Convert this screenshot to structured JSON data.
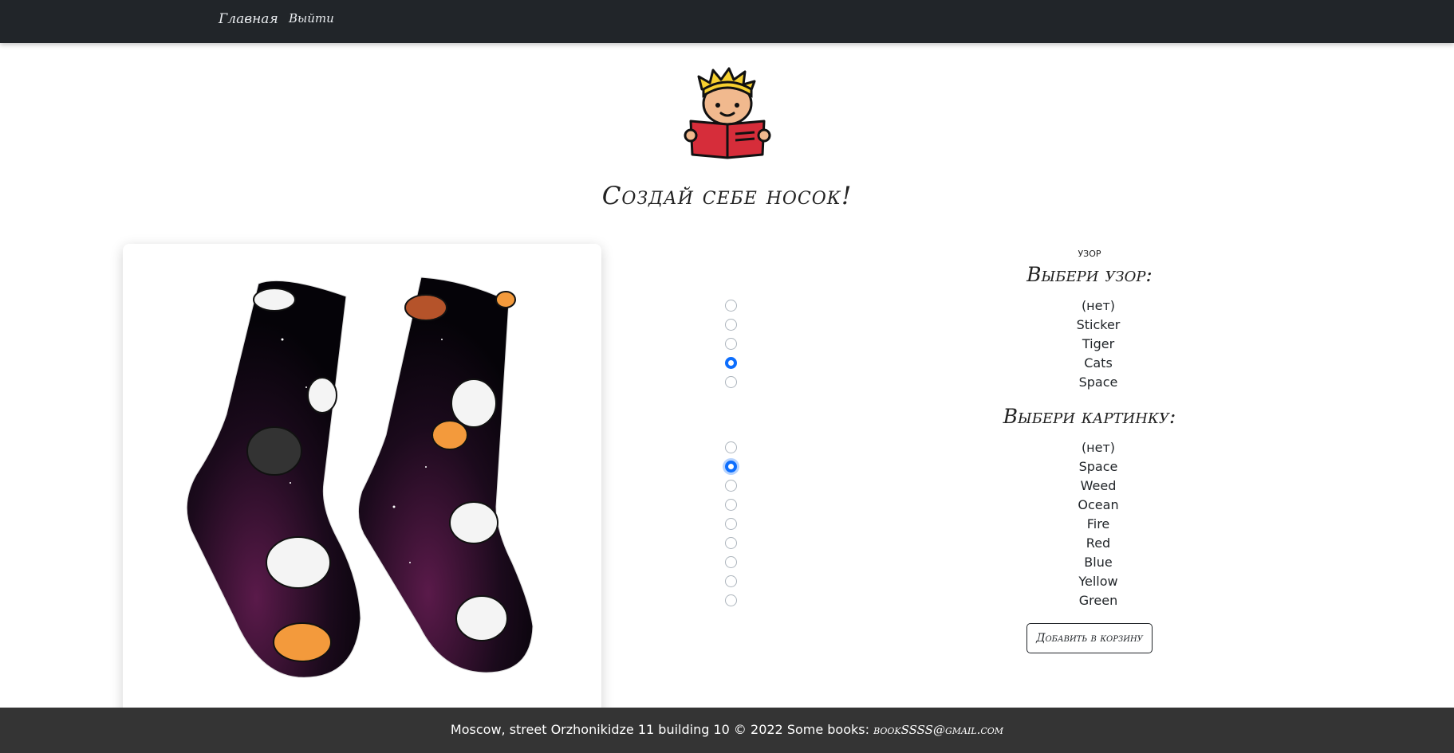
{
  "nav": {
    "home_label": "Главная",
    "logout_label": "Выйти"
  },
  "logo": {
    "icon": "reading-boy-icon"
  },
  "page_title": "Создай себе носок!",
  "pattern_section": {
    "caption": "узор",
    "title": "Выбери узор:",
    "options": [
      "(нет)",
      "Sticker",
      "Tiger",
      "Cats",
      "Space"
    ],
    "selected": "Cats"
  },
  "picture_section": {
    "title": "Выбери картинку:",
    "options": [
      "(нет)",
      "Space",
      "Weed",
      "Ocean",
      "Fire",
      "Red",
      "Blue",
      "Yellow",
      "Green"
    ],
    "selected": "Space"
  },
  "add_to_cart_label": "Добавить в корзину",
  "footer": {
    "text": "Moscow, street Orzhonikidze 11 building 10 © 2022 Some books:",
    "email": "bookSSSS@gmail.com"
  },
  "colors": {
    "navbar": "#212529",
    "footer": "#343434",
    "radio_checked": "#0d6efd"
  }
}
